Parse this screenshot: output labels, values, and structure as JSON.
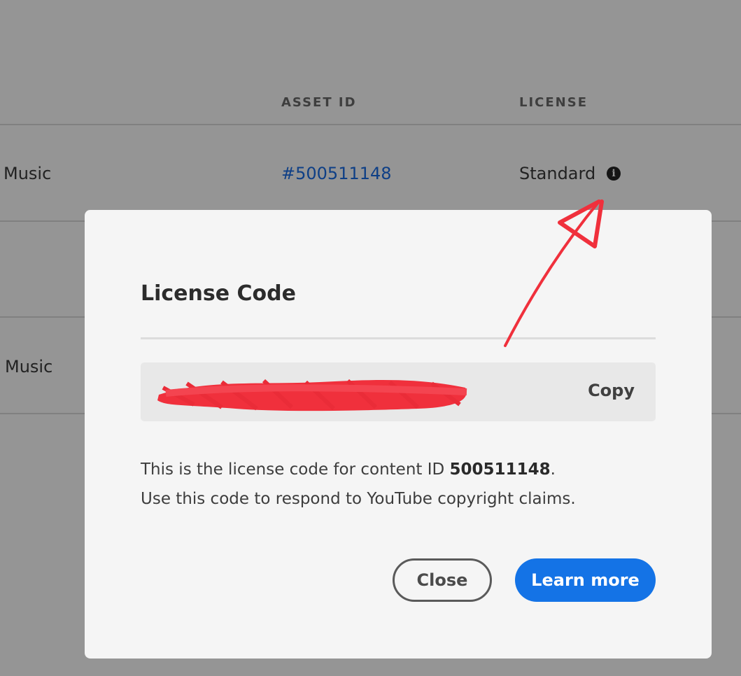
{
  "table": {
    "headers": {
      "asset_id": "ASSET ID",
      "license": "LICENSE"
    },
    "rows": [
      {
        "type": "Music",
        "asset_id": "#500511148",
        "license": "Standard"
      },
      {
        "type": "Music"
      }
    ]
  },
  "modal": {
    "title": "License Code",
    "copy_label": "Copy",
    "description": {
      "line1_prefix": "This is the license code for content ID ",
      "content_id": "500511148",
      "line1_suffix": ".",
      "line2": "Use this code to respond to YouTube copyright claims."
    },
    "close_label": "Close",
    "learn_more_label": "Learn more"
  },
  "colors": {
    "overlay": "#959595",
    "primary_button": "#1473e6",
    "link": "#0e3f86",
    "annotation": "#f0303c"
  },
  "icons": {
    "info": "info-icon"
  }
}
